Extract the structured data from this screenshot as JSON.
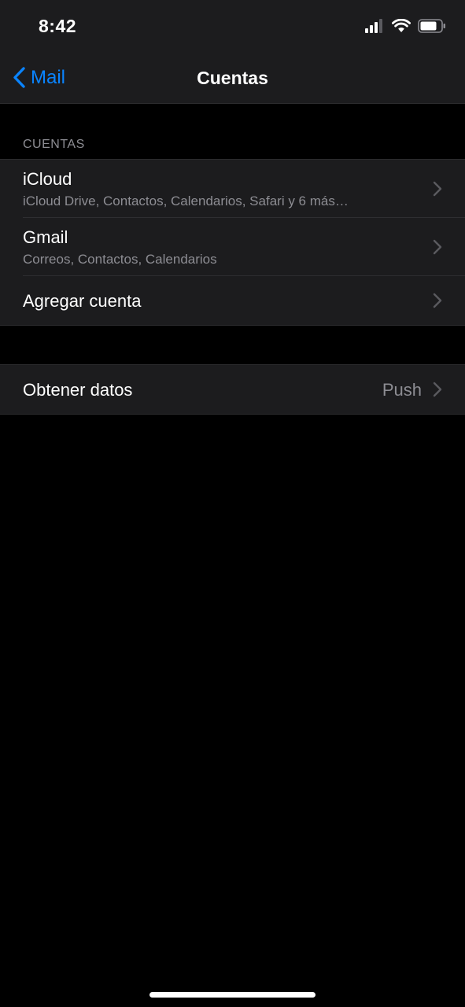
{
  "status_bar": {
    "time": "8:42",
    "icons": [
      "cellular-signal-icon",
      "wifi-icon",
      "battery-icon"
    ]
  },
  "nav": {
    "back_label": "Mail",
    "back_icon": "chevron-left-icon",
    "title": "Cuentas"
  },
  "accounts_section": {
    "header": "CUENTAS",
    "items": [
      {
        "title": "iCloud",
        "subtitle": "iCloud Drive, Contactos, Calendarios, Safari y 6 más…"
      },
      {
        "title": "Gmail",
        "subtitle": "Correos, Contactos, Calendarios"
      },
      {
        "title": "Agregar cuenta"
      }
    ]
  },
  "fetch_section": {
    "title": "Obtener datos",
    "value": "Push"
  },
  "colors": {
    "background": "#000000",
    "cell": "#1c1c1e",
    "accent": "#0a84ff",
    "secondary_text": "#8d8d93",
    "chevron": "#5a5a5f"
  }
}
